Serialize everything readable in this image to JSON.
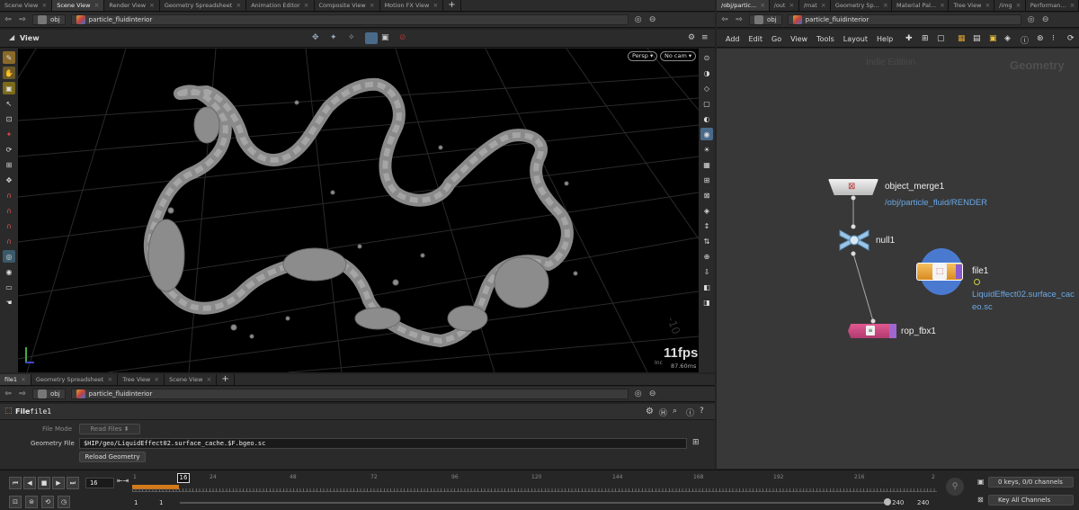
{
  "left_tabs": [
    "Scene View",
    "Scene View",
    "Render View",
    "Geometry Spreadsheet",
    "Animation Editor",
    "Composite View",
    "Motion FX View"
  ],
  "right_tabs": [
    "/obj/partic...",
    "/out",
    "/mat",
    "Geometry Sp...",
    "Material Pal...",
    "Tree View",
    "/img",
    "Performan..."
  ],
  "path": {
    "obj": "obj",
    "context": "particle_fluidinterior"
  },
  "viewport": {
    "title": "View",
    "persp": "Persp",
    "cam": "No cam",
    "fps": "11fps",
    "ms": "87.60ms",
    "corner_hint": "Inc"
  },
  "netview": {
    "menus": [
      "Add",
      "Edit",
      "Go",
      "View",
      "Tools",
      "Layout",
      "Help"
    ],
    "edition": "Indie Edition",
    "context_label": "Geometry",
    "nodes": {
      "object_merge": {
        "name": "object_merge1",
        "sub": "/obj/particle_fluid/RENDER"
      },
      "null": {
        "name": "null1"
      },
      "file": {
        "name": "file1",
        "sub1": "LiquidEffect02.surface_cac",
        "sub2": "eo.sc"
      },
      "rop": {
        "name": "rop_fbx1"
      }
    }
  },
  "bottom_tabs": [
    "file1",
    "Geometry Spreadsheet",
    "Tree View",
    "Scene View"
  ],
  "params": {
    "type": "File",
    "node_name": "file1",
    "file_mode_label": "File Mode",
    "file_mode_value": "Read Files",
    "geo_file_label": "Geometry File",
    "geo_file_value": "$HIP/geo/LiquidEffect02.surface_cache.$F.bgeo.sc",
    "reload_button": "Reload Geometry"
  },
  "timeline": {
    "current_frame": "16",
    "marker": "16",
    "ticks": [
      "1",
      "24",
      "48",
      "72",
      "96",
      "120",
      "144",
      "168",
      "192",
      "216",
      "2"
    ],
    "start": "1",
    "start2": "1",
    "end1": "240",
    "end2": "240",
    "keys_label": "0 keys, 0/0 channels",
    "key_all": "Key All Channels"
  }
}
